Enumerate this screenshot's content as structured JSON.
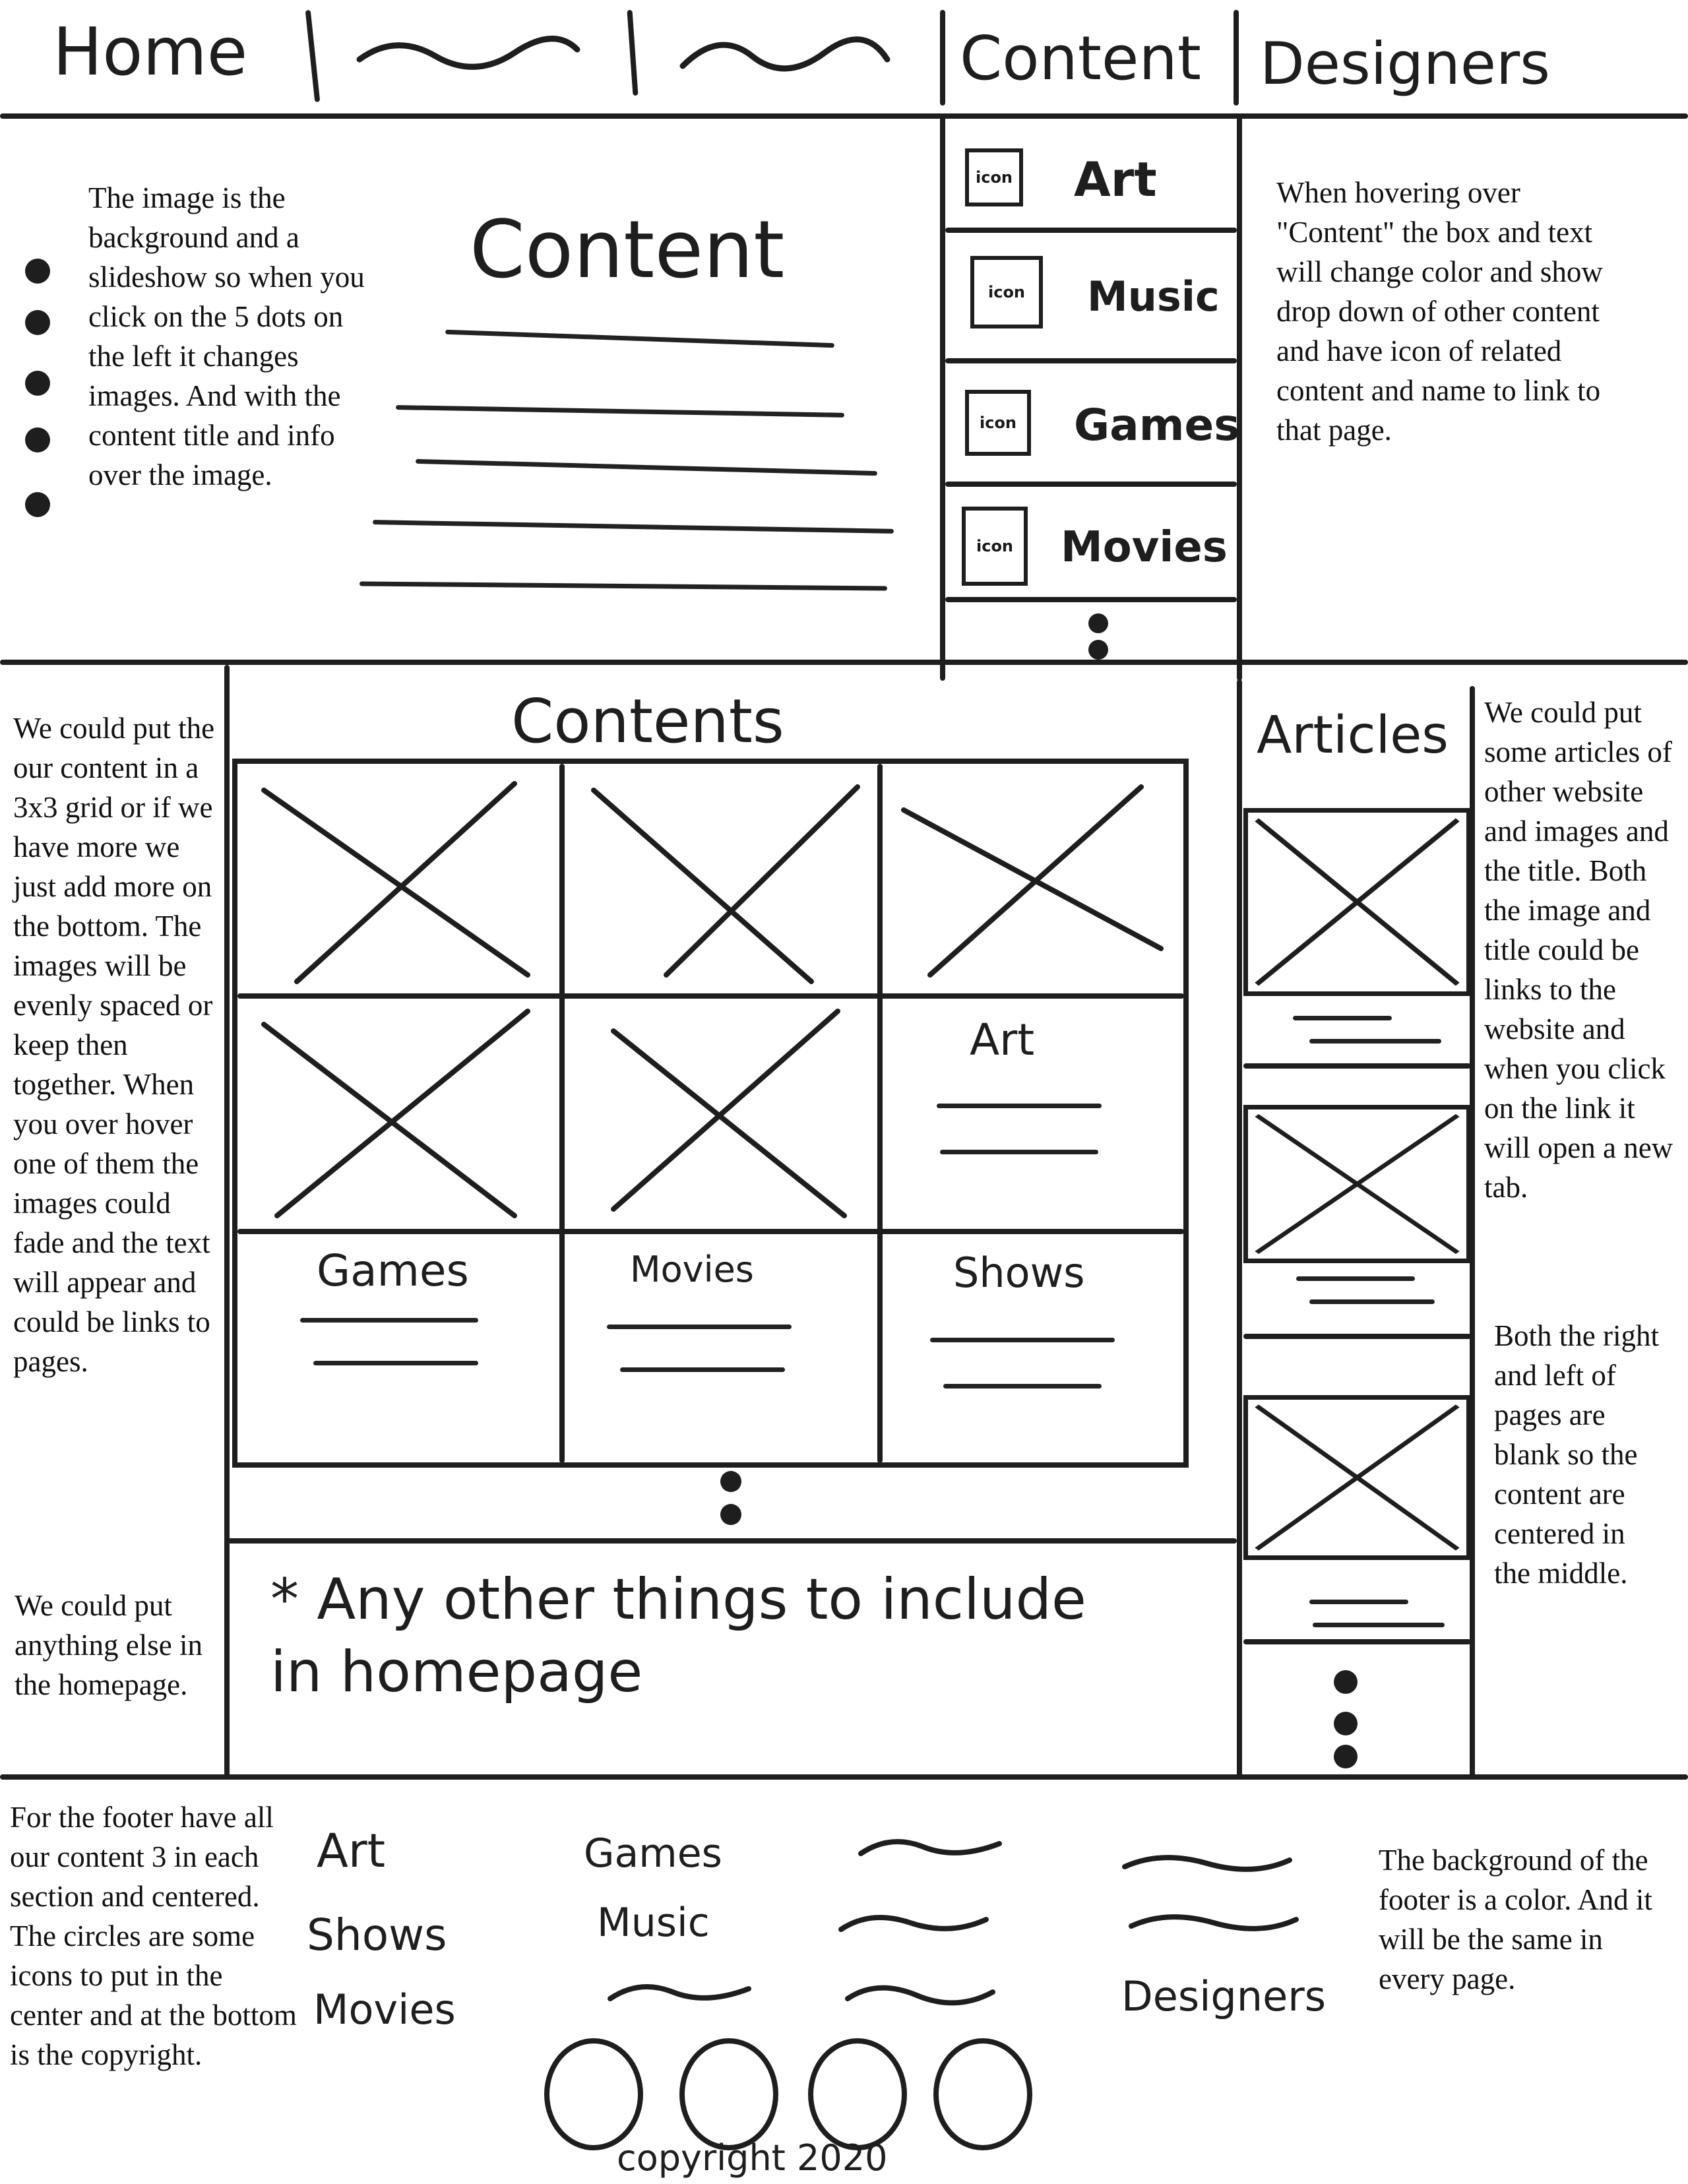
{
  "nav": {
    "home": "Home",
    "content": "Content",
    "designers": "Designers"
  },
  "hero": {
    "note": "The image is the background and a slideshow so when you click on the 5 dots on the left it changes images. And with the content title and info over the image.",
    "title": "Content"
  },
  "dropdown": {
    "items": [
      {
        "icon": "icon",
        "label": "Art"
      },
      {
        "icon": "icon",
        "label": "Music"
      },
      {
        "icon": "icon",
        "label": "Games"
      },
      {
        "icon": "icon",
        "label": "Movies"
      }
    ],
    "note": "When hovering over \"Content\" the box and text will change color and show drop down of other content and have icon of related content and name to link to that page."
  },
  "contents": {
    "title": "Contents",
    "note": "We could put the our content in a 3x3 grid or if we have more we just add more on the bottom. The images will be evenly spaced or keep then together. When you over hover one of them the images could fade and the text will appear and could be links to pages.",
    "tiles": [
      "Art",
      "Games",
      "Movies",
      "Shows"
    ]
  },
  "other": {
    "note": "We could put anything else in the homepage.",
    "text": "* Any other things to include in homepage"
  },
  "articles": {
    "title": "Articles",
    "note1": "We could put some articles of other website and images and the title. Both the image and title could be links to the website and when you click on the link it will open a new tab.",
    "note2": "Both the right and left of pages are blank so the content are centered in the middle."
  },
  "footer": {
    "note_left": "For the footer have all our content 3 in each section and centered. The circles are some icons to put in the center and at the bottom is the copyright.",
    "note_right": "The background of the footer is a color. And it will be the same in every page.",
    "col1": [
      "Art",
      "Shows",
      "Movies"
    ],
    "col2": [
      "Games",
      "Music"
    ],
    "col4": "Designers",
    "copyright": "copyright 2020"
  }
}
